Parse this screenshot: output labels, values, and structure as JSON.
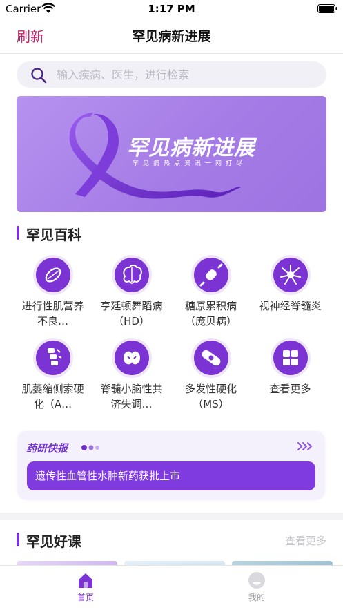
{
  "status_bar": {
    "carrier": "Carrier",
    "time": "1:17 PM"
  },
  "nav": {
    "refresh_label": "刷新",
    "title": "罕见病新进展"
  },
  "search": {
    "placeholder": "输入疾病、医生，进行检索"
  },
  "banner": {
    "title": "罕见病新进展",
    "subtitle": "罕见病热点资讯一网打尽"
  },
  "encyclopedia": {
    "title": "罕见百科",
    "items": [
      {
        "label": "进行性肌营养不良…",
        "icon": "muscle-icon"
      },
      {
        "label": "亨廷顿舞蹈病（HD）",
        "icon": "brain-icon"
      },
      {
        "label": "糖原累积病（庞贝病）",
        "icon": "candy-icon"
      },
      {
        "label": "视神经脊髓炎",
        "icon": "neuron-icon"
      },
      {
        "label": "肌萎缩侧索硬化（A…",
        "icon": "spine-icon"
      },
      {
        "label": "脊髓小脑性共济失调…",
        "icon": "cerebellum-icon"
      },
      {
        "label": "多发性硬化（MS）",
        "icon": "bandage-icon"
      },
      {
        "label": "查看更多",
        "icon": "grid-icon"
      }
    ]
  },
  "news": {
    "logo_text": "药研快报",
    "headline": "遗传性血管性水肿新药获批上市"
  },
  "courses": {
    "title": "罕见好课",
    "more_label": "查看更多"
  },
  "tab_bar": {
    "home_label": "首页",
    "me_label": "我的"
  },
  "colors": {
    "accent": "#7b33d3",
    "refresh": "#c8226b",
    "banner": "#a57ce6"
  }
}
